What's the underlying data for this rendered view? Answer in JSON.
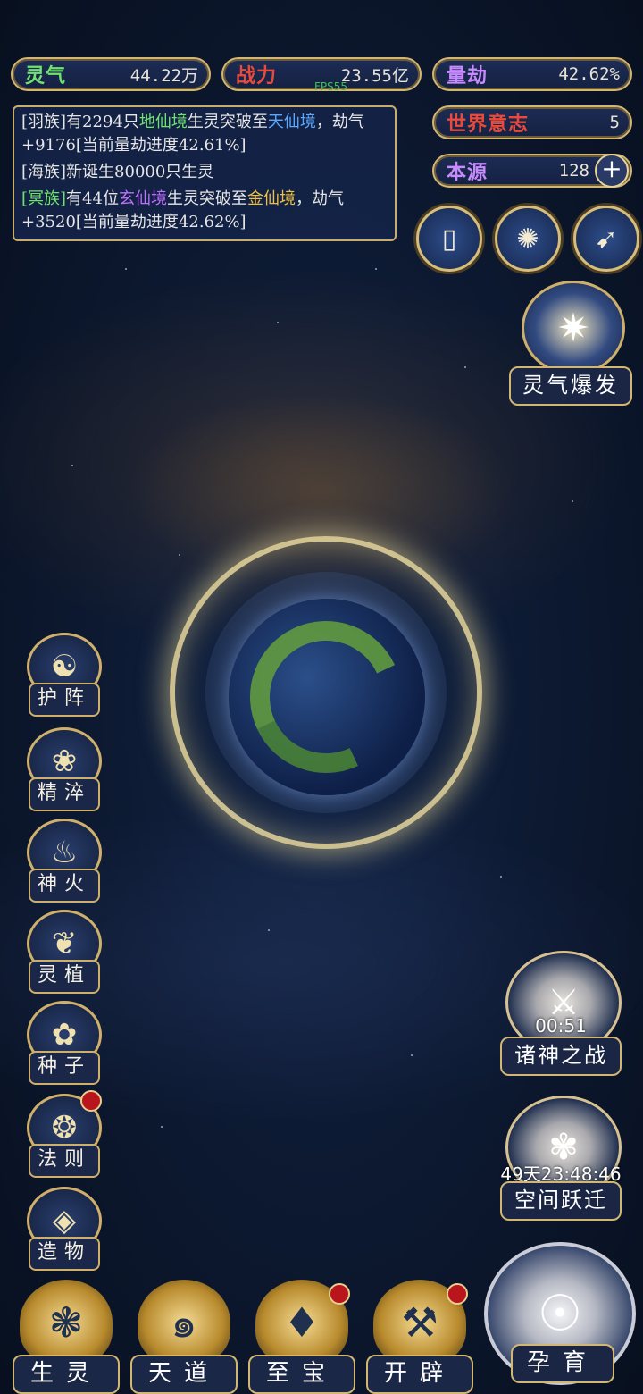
{
  "stats": {
    "lingqi": {
      "label": "灵气",
      "value": "44.22万",
      "color": "#6fe36f"
    },
    "zhanli": {
      "label": "战力",
      "value": "23.55亿",
      "color": "#e84b3c"
    },
    "liangjie": {
      "label": "量劫",
      "value": "42.62%",
      "color": "#c88bff"
    },
    "world_will": {
      "label": "世界意志",
      "value": "5",
      "color": "#e84b3c"
    },
    "benyuan": {
      "label": "本源",
      "value": "128",
      "color": "#c88bff",
      "plus_icon": "plus-icon"
    }
  },
  "fps": "FPS55",
  "log": {
    "entry1": {
      "prefix": "[羽族]有2294只",
      "realm1": "地仙境",
      "mid": "生灵突破至",
      "realm2": "天仙境",
      "suffix": "，劫气+9176[当前量劫进度42.61%]"
    },
    "entry2": {
      "text": "[海族]新诞生80000只生灵"
    },
    "entry3": {
      "clan": "[冥族]",
      "prefix": "有44位",
      "realm1": "玄仙境",
      "mid": "生灵突破至",
      "realm2": "金仙境",
      "suffix": "，劫气+3520[当前量劫进度42.62%]"
    }
  },
  "round_buttons": [
    "card-icon",
    "vortex-icon",
    "scroll-icon"
  ],
  "burst": {
    "label": "灵气爆发",
    "icon": "spiked-wheel-icon"
  },
  "side_buttons": [
    {
      "label": "护阵",
      "icon": "taiji-icon",
      "glyph": "☯"
    },
    {
      "label": "精淬",
      "icon": "lotus-icon",
      "glyph": "❀"
    },
    {
      "label": "神火",
      "icon": "flame-icon",
      "glyph": "♨"
    },
    {
      "label": "灵植",
      "icon": "plant-icon",
      "glyph": "❦"
    },
    {
      "label": "种子",
      "icon": "seed-icon",
      "glyph": "✿"
    },
    {
      "label": "法则",
      "icon": "beast-icon",
      "glyph": "❂"
    },
    {
      "label": "造物",
      "icon": "diamond-icon",
      "glyph": "◈"
    }
  ],
  "right_panel": {
    "war": {
      "label": "诸神之战",
      "timer": "00:51",
      "icon": "sword-icon"
    },
    "leap": {
      "label": "空间跃迁",
      "timer": "49天23:48:46",
      "icon": "flower-swirl-icon"
    },
    "nurture": {
      "label": "孕育",
      "icon": "embryo-icon"
    }
  },
  "bottom_buttons": [
    {
      "label": "生灵",
      "icon": "phoenix-icon",
      "glyph": "❃"
    },
    {
      "label": "天道",
      "icon": "cloud-swirl-icon",
      "glyph": "๑"
    },
    {
      "label": "至宝",
      "icon": "treasure-icon",
      "glyph": "♦"
    },
    {
      "label": "开辟",
      "icon": "axe-icon",
      "glyph": "⚒"
    }
  ],
  "colors": {
    "gold": "#d2b673",
    "green_realm": "#6fe36f",
    "blue_realm": "#5aa9ff",
    "purple_realm": "#c070ff",
    "gold_realm": "#f0c040",
    "red_dot": "#b8161c"
  }
}
